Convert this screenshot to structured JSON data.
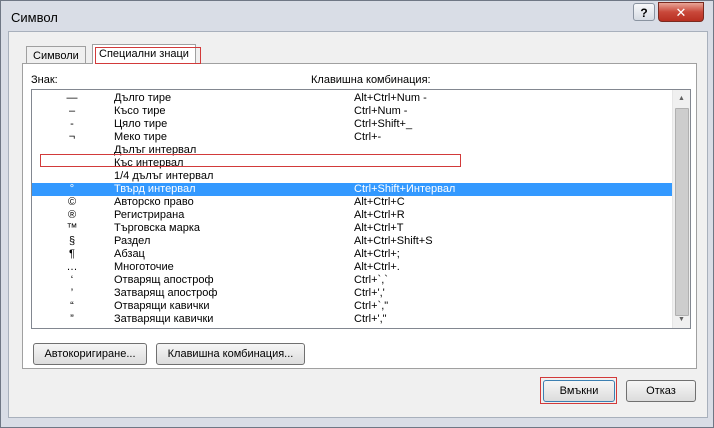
{
  "window": {
    "title": "Символ",
    "help_label": "?",
    "close_label": "✕"
  },
  "tabs": [
    {
      "label": "Символи",
      "active": false
    },
    {
      "label": "Специални знаци",
      "active": true
    }
  ],
  "headers": {
    "sign": "Знак:",
    "shortcut": "Клавишна комбинация:"
  },
  "rows": [
    {
      "sym": "—",
      "name": "Дълго тире",
      "key": "Alt+Ctrl+Num -"
    },
    {
      "sym": "–",
      "name": "Късо тире",
      "key": "Ctrl+Num -"
    },
    {
      "sym": "-",
      "name": "Цяло тире",
      "key": "Ctrl+Shift+_"
    },
    {
      "sym": "¬",
      "name": "Меко тире",
      "key": "Ctrl+-"
    },
    {
      "sym": "",
      "name": "Дълъг интервал",
      "key": ""
    },
    {
      "sym": "",
      "name": "Къс интервал",
      "key": ""
    },
    {
      "sym": "",
      "name": "1/4 дълъг интервал",
      "key": ""
    },
    {
      "sym": "°",
      "name": "Твърд интервал",
      "key": "Ctrl+Shift+Интервал",
      "selected": true
    },
    {
      "sym": "©",
      "name": "Авторско право",
      "key": "Alt+Ctrl+C"
    },
    {
      "sym": "®",
      "name": "Регистрирана",
      "key": "Alt+Ctrl+R"
    },
    {
      "sym": "™",
      "name": "Търговска марка",
      "key": "Alt+Ctrl+T"
    },
    {
      "sym": "§",
      "name": "Раздел",
      "key": "Alt+Ctrl+Shift+S"
    },
    {
      "sym": "¶",
      "name": "Абзац",
      "key": "Alt+Ctrl+;"
    },
    {
      "sym": "…",
      "name": "Многоточие",
      "key": "Alt+Ctrl+."
    },
    {
      "sym": "‘",
      "name": "Отварящ апостроф",
      "key": "Ctrl+`,`"
    },
    {
      "sym": "’",
      "name": "Затварящ апостроф",
      "key": "Ctrl+',' "
    },
    {
      "sym": "“",
      "name": "Отварящи кавички",
      "key": "Ctrl+`,\""
    },
    {
      "sym": "”",
      "name": "Затварящи кавички",
      "key": "Ctrl+',\""
    }
  ],
  "buttons": {
    "autocorrect": "Автокоригиране...",
    "shortcut": "Клавишна комбинация...",
    "insert": "Вмъкни",
    "cancel": "Отказ"
  },
  "icons": {
    "scroll_up": "scroll-up-arrow-icon",
    "scroll_down": "scroll-down-arrow-icon"
  },
  "colors": {
    "selection": "#3399ff",
    "focus_outline": "#d23a3a",
    "close_button": "#c9483a"
  }
}
